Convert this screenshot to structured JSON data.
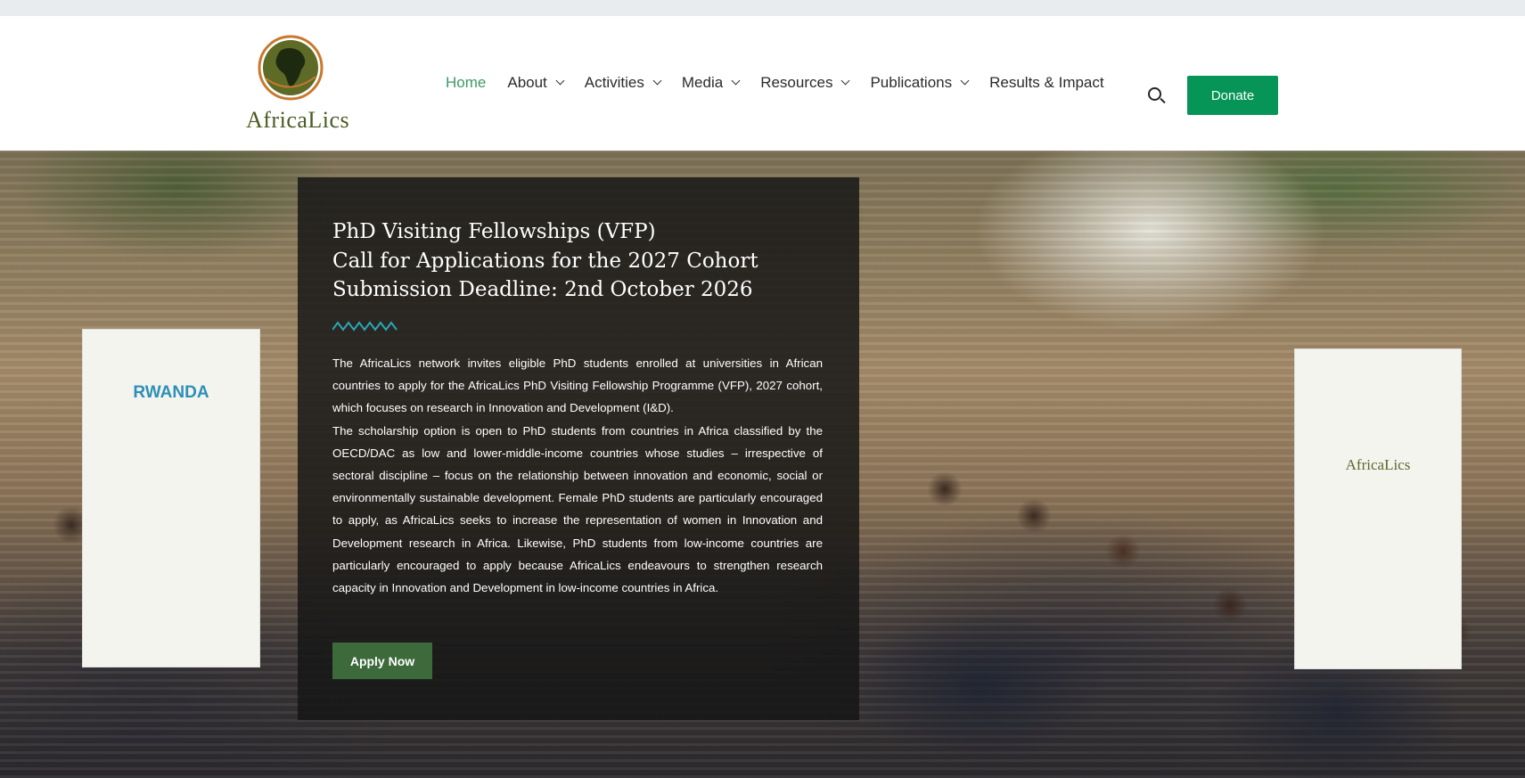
{
  "header": {
    "logo_text": "AfricaLics",
    "nav": [
      {
        "label": "Home",
        "active": true,
        "dropdown": false
      },
      {
        "label": "About",
        "active": false,
        "dropdown": true
      },
      {
        "label": "Activities",
        "active": false,
        "dropdown": true
      },
      {
        "label": "Media",
        "active": false,
        "dropdown": true
      },
      {
        "label": "Resources",
        "active": false,
        "dropdown": true
      },
      {
        "label": "Publications",
        "active": false,
        "dropdown": true
      },
      {
        "label": "Results & Impact",
        "active": false,
        "dropdown": false
      }
    ],
    "search_icon": "search-icon",
    "donate_label": "Donate"
  },
  "hero": {
    "headline_lines": [
      "PhD Visiting Fellowships (VFP)",
      "Call for Applications for the 2027 Cohort",
      "Submission Deadline: 2nd October 2026"
    ],
    "paragraph_1": "The AfricaLics network invites eligible PhD students enrolled at universities in African countries to apply for the AfricaLics PhD Visiting Fellowship Programme (VFP), 2027 cohort, which focuses on research in Innovation and Development (I&D).",
    "paragraph_2": "The scholarship option is open to PhD students from countries in Africa classified by the OECD/DAC as low and lower-middle-income countries whose studies – irrespective of sectoral discipline – focus on the relationship between innovation and economic, social or environmentally sustainable development. Female PhD students are particularly encouraged to apply, as AfricaLics seeks to increase the representation of women in Innovation and Development research in Africa. Likewise, PhD students from low-income countries are particularly encouraged to apply because AfricaLics endeavours to strengthen research capacity in Innovation and Development in low-income countries in Africa.",
    "apply_label": "Apply Now",
    "banner_left_text": "RWANDA",
    "banner_right_text": "AfricaLics"
  },
  "colors": {
    "accent_green": "#079457",
    "nav_active": "#3c9a63",
    "apply_button": "#3c6a3a",
    "zigzag": "#2aa7b8"
  }
}
